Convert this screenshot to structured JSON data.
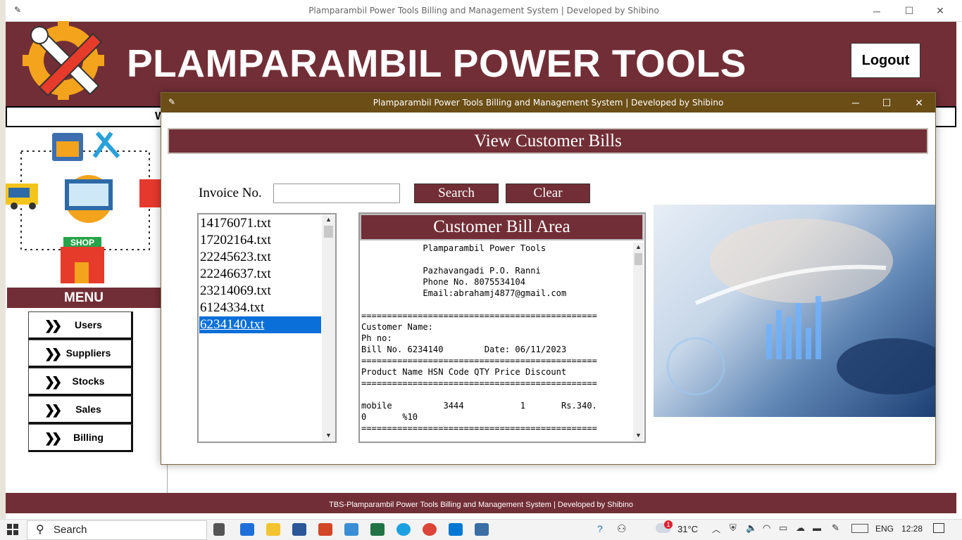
{
  "main_window": {
    "title": "Plamparambil Power Tools Billing and Management System |  Developed by Shibino",
    "app_title": "PLAMPARAMBIL POWER TOOLS",
    "logout_label": "Logout",
    "welcome_prefix": "W",
    "menu_header": "MENU",
    "menu_items": [
      {
        "label": "Users"
      },
      {
        "label": "Suppliers"
      },
      {
        "label": "Stocks"
      },
      {
        "label": "Sales"
      },
      {
        "label": "Billing"
      }
    ],
    "footer_text": "TBS-Plamparambil Power Tools Billing and Management System |  Developed by Shibino",
    "brand_color": "#722e36"
  },
  "dialog": {
    "title": "Plamparambil Power Tools Billing and Management System |  Developed by Shibino",
    "heading": "View Customer Bills",
    "invoice_label": "Invoice No.",
    "invoice_value": "",
    "search_label": "Search",
    "clear_label": "Clear",
    "files": [
      {
        "name": "14176071.txt",
        "selected": false
      },
      {
        "name": "17202164.txt",
        "selected": false
      },
      {
        "name": "22245623.txt",
        "selected": false
      },
      {
        "name": "22246637.txt",
        "selected": false
      },
      {
        "name": "23214069.txt",
        "selected": false
      },
      {
        "name": "6124334.txt",
        "selected": false
      },
      {
        "name": "6234140.txt",
        "selected": true
      }
    ],
    "bill_area_title": "Customer Bill Area",
    "bill_lines": [
      "            Plamparambil Power Tools",
      "",
      "            Pazhavangadi P.O. Ranni",
      "            Phone No. 8075534104",
      "            Email:abrahamj4877@gmail.com",
      "",
      "==============================================",
      "Customer Name:",
      "Ph no:",
      "Bill No. 6234140        Date: 06/11/2023",
      "==============================================",
      "Product Name HSN Code QTY Price Discount",
      "==============================================",
      "",
      "mobile          3444           1       Rs.340.",
      "0       %10",
      "=============================================="
    ]
  },
  "taskbar": {
    "search_label": "Search",
    "weather_temp": "31°C",
    "language": "ENG",
    "time": "12:28",
    "notification_count": "1"
  }
}
